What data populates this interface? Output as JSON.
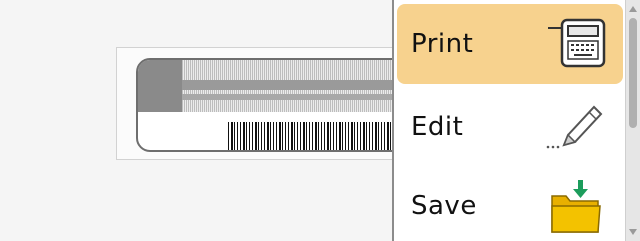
{
  "menu": {
    "items": [
      {
        "label": "Print",
        "icon": "printer-icon",
        "active": true
      },
      {
        "label": "Edit",
        "icon": "pencil-icon",
        "active": false
      },
      {
        "label": "Save",
        "icon": "folder-save-icon",
        "active": false
      }
    ]
  },
  "colors": {
    "active_item": "#f7d28e",
    "folder": "#f3c200",
    "save_arrow": "#1c9d5c"
  },
  "label_preview": {
    "icon": "barcode-icon"
  }
}
